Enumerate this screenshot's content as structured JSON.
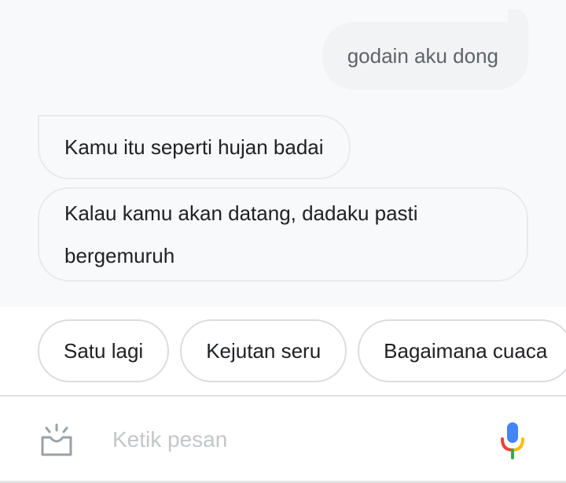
{
  "conversation": {
    "user_message": "godain aku dong",
    "assistant_messages": [
      "Kamu itu seperti hujan badai",
      "Kalau kamu akan datang, dadaku pasti bergemuruh"
    ]
  },
  "suggestions": [
    "Satu lagi",
    "Kejutan seru",
    "Bagaimana cuaca"
  ],
  "composer": {
    "placeholder": "Ketik pesan",
    "value": "",
    "left_icon": "lens-icon",
    "right_icon": "mic-icon"
  },
  "colors": {
    "chat_background": "#f8f9fa",
    "user_bubble": "#f1f3f4",
    "bubble_border": "#e8eaed",
    "mic_blue": "#4285f4",
    "mic_red": "#ea4335",
    "mic_yellow": "#fbbc05",
    "mic_green": "#34a853"
  }
}
